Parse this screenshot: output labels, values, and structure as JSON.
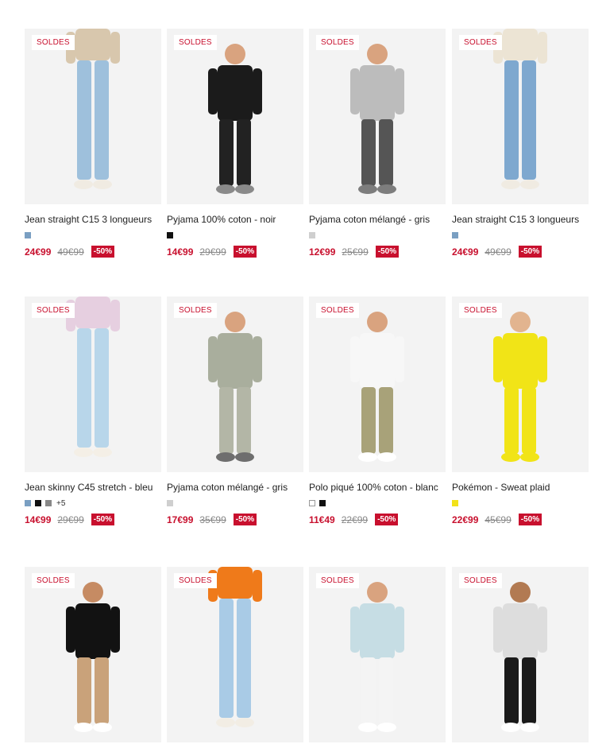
{
  "products": [
    {
      "badge": "SOLDES",
      "title": "Jean straight C15 3 longueurs",
      "swatches": [
        "#7a9fc2"
      ],
      "more": "",
      "price": "24€99",
      "old_price": "49€99",
      "discount": "-50%",
      "figure": {
        "top": "#d8c7ad",
        "bottom": "#9ec0dc",
        "shoes": "#f0ebe2",
        "skin": "#e2b48f"
      }
    },
    {
      "badge": "SOLDES",
      "title": "Pyjama 100% coton - noir",
      "swatches": [
        "#111111"
      ],
      "more": "",
      "price": "14€99",
      "old_price": "29€99",
      "discount": "-50%",
      "figure": {
        "top": "#1b1b1b",
        "bottom": "#222222",
        "shoes": "#8a8a8a",
        "skin": "#d9a37f"
      }
    },
    {
      "badge": "SOLDES",
      "title": "Pyjama coton mélangé - gris",
      "swatches": [
        "#cfcfcf"
      ],
      "more": "",
      "price": "12€99",
      "old_price": "25€99",
      "discount": "-50%",
      "figure": {
        "top": "#bcbcbc",
        "bottom": "#555555",
        "shoes": "#7d7d7d",
        "skin": "#d9a37f"
      }
    },
    {
      "badge": "SOLDES",
      "title": "Jean straight C15 3 longueurs",
      "swatches": [
        "#7a9fc2"
      ],
      "more": "",
      "price": "24€99",
      "old_price": "49€99",
      "discount": "-50%",
      "figure": {
        "top": "#ece4d4",
        "bottom": "#7ea8cf",
        "shoes": "#f0ebe2",
        "skin": "#e2b48f"
      }
    },
    {
      "badge": "SOLDES",
      "title": "Jean skinny C45 stretch - bleu",
      "swatches": [
        "#7a9fc2",
        "#111111",
        "#888888"
      ],
      "more": "+5",
      "price": "14€99",
      "old_price": "29€99",
      "discount": "-50%",
      "figure": {
        "top": "#e6cfe0",
        "bottom": "#b8d6ea",
        "shoes": "#f4efe6",
        "skin": "#e2b48f"
      }
    },
    {
      "badge": "SOLDES",
      "title": "Pyjama coton mélangé - gris",
      "swatches": [
        "#cfcfcf"
      ],
      "more": "",
      "price": "17€99",
      "old_price": "35€99",
      "discount": "-50%",
      "figure": {
        "top": "#a9ae9d",
        "bottom": "#b3b6a6",
        "shoes": "#6e6e6e",
        "skin": "#d9a37f"
      }
    },
    {
      "badge": "SOLDES",
      "title": "Polo piqué 100% coton - blanc",
      "swatches": [
        "#ffffff",
        "#111111"
      ],
      "more": "",
      "price": "11€49",
      "old_price": "22€99",
      "discount": "-50%",
      "figure": {
        "top": "#f7f7f7",
        "bottom": "#a8a279",
        "shoes": "#ffffff",
        "skin": "#d9a37f"
      }
    },
    {
      "badge": "SOLDES",
      "title": "Pokémon - Sweat plaid",
      "swatches": [
        "#f2e21a"
      ],
      "more": "",
      "price": "22€99",
      "old_price": "45€99",
      "discount": "-50%",
      "figure": {
        "top": "#f1e417",
        "bottom": "#f1e417",
        "shoes": "#f1e417",
        "skin": "#e2b48f"
      }
    },
    {
      "badge": "SOLDES",
      "title": "",
      "swatches": [],
      "more": "",
      "price": "",
      "old_price": "",
      "discount": "",
      "figure": {
        "top": "#121212",
        "bottom": "#c9a27a",
        "shoes": "#ffffff",
        "skin": "#c68b63"
      }
    },
    {
      "badge": "SOLDES",
      "title": "",
      "swatches": [],
      "more": "",
      "price": "",
      "old_price": "",
      "discount": "",
      "figure": {
        "top": "#ef7a1a",
        "bottom": "#a9cbe6",
        "shoes": "#f2ede4",
        "skin": "#e2b48f"
      }
    },
    {
      "badge": "SOLDES",
      "title": "",
      "swatches": [],
      "more": "",
      "price": "",
      "old_price": "",
      "discount": "",
      "figure": {
        "top": "#c6dde4",
        "bottom": "#f4f4f4",
        "shoes": "#ffffff",
        "skin": "#d9a37f"
      }
    },
    {
      "badge": "SOLDES",
      "title": "",
      "swatches": [],
      "more": "",
      "price": "",
      "old_price": "",
      "discount": "",
      "figure": {
        "top": "#dddddd",
        "bottom": "#1a1a1a",
        "shoes": "#ffffff",
        "skin": "#b27a52"
      }
    }
  ]
}
